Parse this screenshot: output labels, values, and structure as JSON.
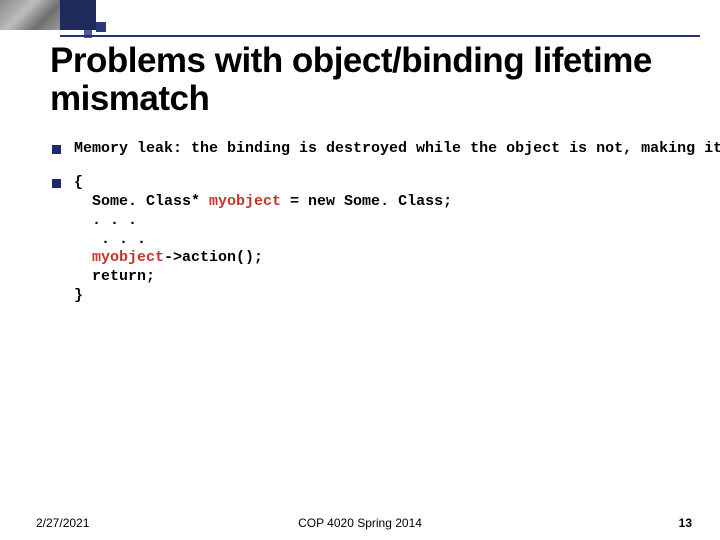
{
  "title": "Problems with object/binding lifetime mismatch",
  "bullet1": "Memory leak: the binding is destroyed while the object is not, making it noway to access/delete the object",
  "code": {
    "l1": "{",
    "l2": "  Some. Class* ",
    "l2b": "myobject",
    "l2c": " = new Some. Class;",
    "l3": "  . . .",
    "l4": "   . . .",
    "l5": "  ",
    "l5b": "myobject",
    "l5c": "->action();",
    "l6": "  return;",
    "l7": "}"
  },
  "footer": {
    "date": "2/27/2021",
    "course": "COP 4020 Spring 2014",
    "page": "13"
  }
}
